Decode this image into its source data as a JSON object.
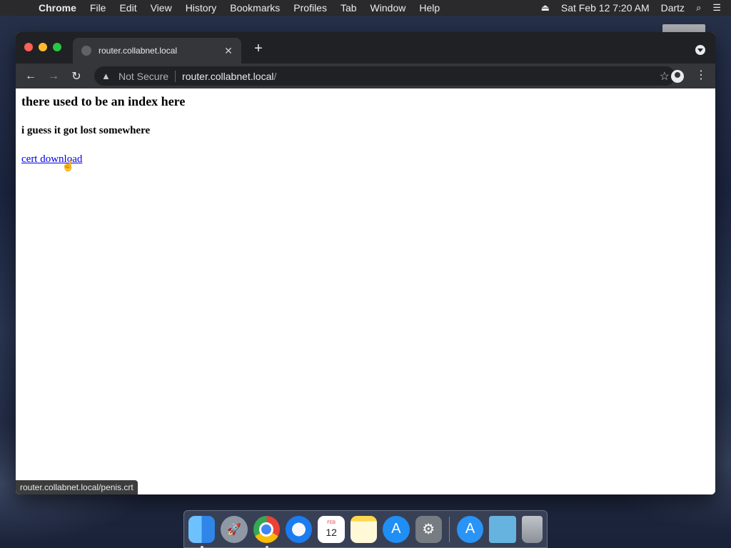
{
  "menubar": {
    "apple_icon": "apple-icon",
    "items": [
      "Chrome",
      "File",
      "Edit",
      "View",
      "History",
      "Bookmarks",
      "Profiles",
      "Tab",
      "Window",
      "Help"
    ],
    "datetime": "Sat Feb 12  7:20 AM",
    "user": "Dartz"
  },
  "browser": {
    "tab": {
      "title": "router.collabnet.local"
    },
    "omnibox": {
      "security_label": "Not Secure",
      "url_host": "router.collabnet.local",
      "url_path": "/"
    },
    "statusbar": "router.collabnet.local/penis.crt"
  },
  "page": {
    "heading": "there used to be an index here",
    "subheading": "i guess it got lost somewhere",
    "link_label": "cert download"
  },
  "dock": {
    "calendar_month": "FEB",
    "calendar_day": "12"
  },
  "colors": {
    "link": "#0000ee",
    "tab_bg": "#35363a",
    "chrome_frame": "#202124"
  }
}
